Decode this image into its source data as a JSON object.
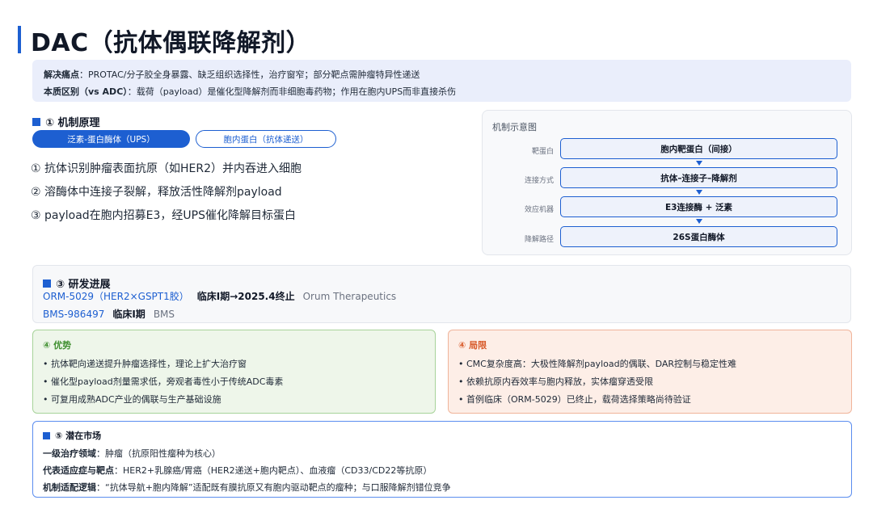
{
  "title": "DAC（抗体偶联降解剂）",
  "pain": {
    "label1": "解决痛点",
    "text1": "：PROTAC/分子胶全身暴露、缺乏组织选择性，治疗窗窄；部分靶点需肿瘤特异性递送",
    "label2": "本质区别（vs ADC）",
    "text2": "：载荷（payload）是催化型降解剂而非细胞毒药物；作用在胞内UPS而非直接杀伤"
  },
  "mechanism": {
    "heading": "① 机制原理",
    "pill_active": "泛素-蛋白酶体（UPS）",
    "pill_outline": "胞内蛋白（抗体递送）",
    "steps": [
      "① 抗体识别肿瘤表面抗原（如HER2）并内吞进入细胞",
      "② 溶酶体中连接子裂解，释放活性降解剂payload",
      "③ payload在胞内招募E3，经UPS催化降解目标蛋白"
    ]
  },
  "diagram": {
    "title": "机制示意图",
    "rows": [
      {
        "label": "靶蛋白",
        "box": "胞内靶蛋白（间接）"
      },
      {
        "label": "连接方式",
        "box": "抗体–连接子–降解剂"
      },
      {
        "label": "效应机器",
        "box": "E3连接酶 + 泛素"
      },
      {
        "label": "降解路径",
        "box": "26S蛋白酶体"
      }
    ]
  },
  "progress": {
    "heading": "③ 研发进展",
    "items": [
      {
        "name": "ORM-5029（HER2×GSPT1胶）",
        "status": "临床I期→2025.4终止",
        "org": "Orum Therapeutics"
      },
      {
        "name": "BMS-986497",
        "status": "临床I期",
        "org": "BMS"
      }
    ]
  },
  "advantages": {
    "heading": "④ 优势",
    "items": [
      "• 抗体靶向递送提升肿瘤选择性，理论上扩大治疗窗",
      "• 催化型payload剂量需求低，旁观者毒性小于传统ADC毒素",
      "• 可复用成熟ADC产业的偶联与生产基础设施"
    ]
  },
  "limitations": {
    "heading": "④ 局限",
    "items": [
      "• CMC复杂度高：大极性降解剂payload的偶联、DAR控制与稳定性难",
      "• 依赖抗原内吞效率与胞内释放，实体瘤穿透受限",
      "• 首例临床（ORM-5029）已终止，载荷选择策略尚待验证"
    ]
  },
  "market": {
    "heading": "⑤ 潜在市场",
    "rows": [
      {
        "label": "一级治疗领域",
        "text": "：肿瘤（抗原阳性瘤种为核心）"
      },
      {
        "label": "代表适应症与靶点",
        "text": "：HER2+乳腺癌/胃癌（HER2递送+胞内靶点）、血液瘤（CD33/CD22等抗原）"
      },
      {
        "label": "机制适配逻辑",
        "text": "：“抗体导航+胞内降解”适配既有膜抗原又有胞内驱动靶点的瘤种；与口服降解剂错位竞争"
      }
    ]
  },
  "colors": {
    "accent": "#1d5fd1",
    "advantage": "#3f8f2f",
    "limitation": "#d85a2a"
  }
}
